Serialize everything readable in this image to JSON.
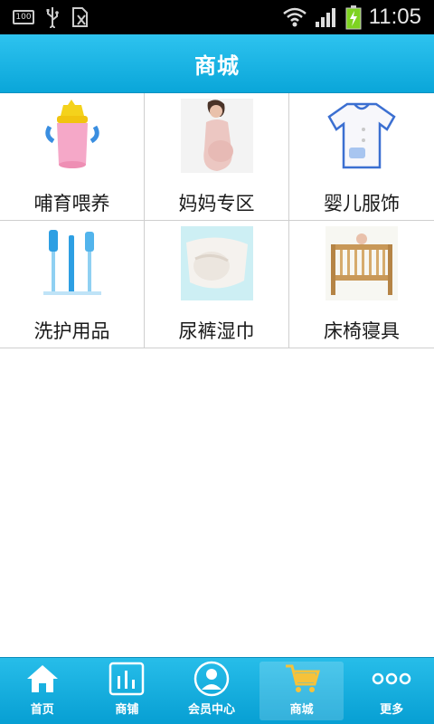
{
  "status_bar": {
    "battery_left_text": "100",
    "time": "11:05",
    "battery_color": "#7ed321"
  },
  "header": {
    "title": "商城",
    "color": "#16b2e4"
  },
  "categories": [
    {
      "label": "哺育喂养",
      "icon": "sippy-cup-image"
    },
    {
      "label": "妈妈专区",
      "icon": "maternity-wear-image"
    },
    {
      "label": "婴儿服饰",
      "icon": "baby-shirt-image"
    },
    {
      "label": "洗护用品",
      "icon": "bottle-brush-image"
    },
    {
      "label": "尿裤湿巾",
      "icon": "diaper-image"
    },
    {
      "label": "床椅寝具",
      "icon": "crib-image"
    }
  ],
  "tabbar": {
    "active": "商城",
    "items": [
      {
        "label": "首页",
        "icon": "home-icon"
      },
      {
        "label": "商铺",
        "icon": "shop-chart-icon"
      },
      {
        "label": "会员中心",
        "icon": "member-icon"
      },
      {
        "label": "商城",
        "icon": "cart-icon"
      },
      {
        "label": "更多",
        "icon": "more-dots-icon"
      }
    ]
  }
}
